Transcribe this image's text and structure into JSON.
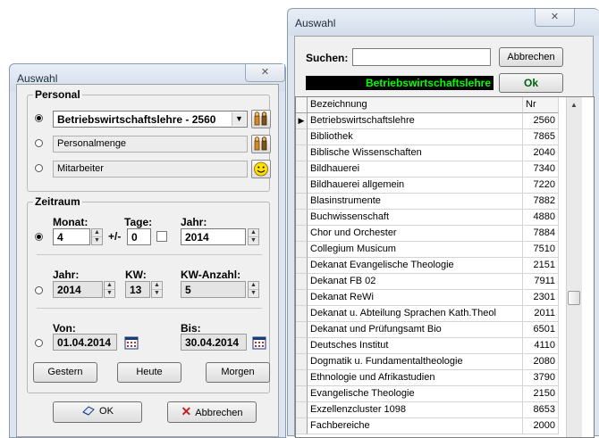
{
  "left_dialog": {
    "title": "Auswahl",
    "close_glyph": "✕",
    "personal": {
      "legend": "Personal",
      "options": [
        {
          "value": "Betriebswirtschaftslehre - 2560",
          "selected": true,
          "icon": "group-icon"
        },
        {
          "value": "Personalmenge",
          "selected": false,
          "icon": "group-icon"
        },
        {
          "value": "Mitarbeiter",
          "selected": false,
          "icon": "smiley-icon"
        }
      ]
    },
    "zeitraum": {
      "legend": "Zeitraum",
      "monat_label": "Monat:",
      "monat_value": "4",
      "tage_label": "Tage:",
      "tage_prefix": "+/-",
      "tage_value": "0",
      "jahr_label": "Jahr:",
      "jahr_value": "2014",
      "jahr2_label": "Jahr:",
      "jahr2_value": "2014",
      "kw_label": "KW:",
      "kw_value": "13",
      "kw_anzahl_label": "KW-Anzahl:",
      "kw_anzahl_value": "5",
      "von_label": "Von:",
      "von_value": "01.04.2014",
      "bis_label": "Bis:",
      "bis_value": "30.04.2014",
      "selected_mode": "monat",
      "buttons": {
        "gestern": "Gestern",
        "heute": "Heute",
        "morgen": "Morgen"
      }
    },
    "ok_label": "OK",
    "abbrechen_label": "Abbrechen"
  },
  "right_dialog": {
    "title": "Auswahl",
    "close_glyph": "✕",
    "suchen_label": "Suchen:",
    "suchen_value": "",
    "abbrechen_label": "Abbrechen",
    "selected_display": "Betriebswirtschaftslehre",
    "ok_label": "Ok",
    "colors": {
      "display_bg": "#000000",
      "display_fg": "#00ff00"
    },
    "grid": {
      "columns": [
        "Bezeichnung",
        "Nr"
      ],
      "rows": [
        {
          "name": "Betriebswirtschaftslehre",
          "nr": "2560"
        },
        {
          "name": "Bibliothek",
          "nr": "7865"
        },
        {
          "name": "Biblische Wissenschaften",
          "nr": "2040"
        },
        {
          "name": "Bildhauerei",
          "nr": "7340"
        },
        {
          "name": "Bildhauerei allgemein",
          "nr": "7220"
        },
        {
          "name": "Blasinstrumente",
          "nr": "7882"
        },
        {
          "name": "Buchwissenschaft",
          "nr": "4880"
        },
        {
          "name": "Chor und Orchester",
          "nr": "7884"
        },
        {
          "name": "Collegium Musicum",
          "nr": "7510"
        },
        {
          "name": "Dekanat Evangelische Theologie",
          "nr": "2151"
        },
        {
          "name": "Dekanat FB 02",
          "nr": "7911"
        },
        {
          "name": "Dekanat ReWi",
          "nr": "2301"
        },
        {
          "name": "Dekanat u. Abteilung Sprachen Kath.Theol",
          "nr": "2011"
        },
        {
          "name": "Dekanat und Prüfungsamt Bio",
          "nr": "6501"
        },
        {
          "name": "Deutsches Institut",
          "nr": "4110"
        },
        {
          "name": "Dogmatik u. Fundamentaltheologie",
          "nr": "2080"
        },
        {
          "name": "Ethnologie und Afrikastudien",
          "nr": "3790"
        },
        {
          "name": "Evangelische Theologie",
          "nr": "2150"
        },
        {
          "name": "Exzellenzcluster 1098",
          "nr": "8653"
        },
        {
          "name": "Fachbereiche",
          "nr": "2000"
        }
      ],
      "current_row_indicator": "▶"
    }
  }
}
